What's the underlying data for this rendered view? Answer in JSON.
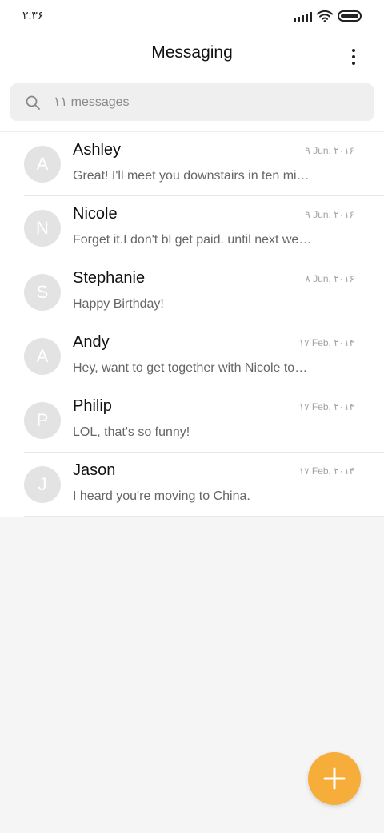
{
  "status_bar": {
    "time": "۲:۳۶",
    "icons": [
      "signal-icon",
      "wifi-icon",
      "battery-icon"
    ]
  },
  "header": {
    "title": "Messaging",
    "menu_icon": "more-vertical-icon"
  },
  "search": {
    "icon": "search-icon",
    "placeholder": "۱۱ messages"
  },
  "conversations": [
    {
      "initial": "A",
      "name": "Ashley",
      "date": "۹ Jun, ۲۰۱۶",
      "preview": "Great! I'll meet you downstairs in ten minutes."
    },
    {
      "initial": "N",
      "name": "Nicole",
      "date": "۹ Jun, ۲۰۱۶",
      "preview": "Forget it.I don't bl get paid. until next week."
    },
    {
      "initial": "S",
      "name": "Stephanie",
      "date": "۸ Jun, ۲۰۱۶",
      "preview": "Happy Birthday!"
    },
    {
      "initial": "A",
      "name": "Andy",
      "date": "۱۷ Feb, ۲۰۱۴",
      "preview": "Hey, want to get together with Nicole tonight?"
    },
    {
      "initial": "P",
      "name": "Philip",
      "date": "۱۷ Feb, ۲۰۱۴",
      "preview": "LOL, that's so funny!"
    },
    {
      "initial": "J",
      "name": "Jason",
      "date": "۱۷ Feb, ۲۰۱۴",
      "preview": "I heard you're moving to China."
    }
  ],
  "fab": {
    "icon": "plus-icon"
  },
  "colors": {
    "accent": "#f7ad3a",
    "avatar_bg": "#e3e3e3",
    "background": "#f5f5f5"
  }
}
